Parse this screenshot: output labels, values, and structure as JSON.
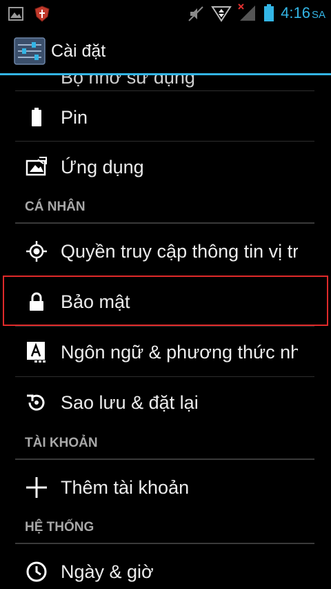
{
  "status_bar": {
    "time": "4:16",
    "ampm": "SA",
    "icons": [
      "gallery-icon",
      "shield-icon",
      "mute-icon",
      "data-arrows-icon",
      "signal-no-service-icon",
      "battery-icon"
    ]
  },
  "action_bar": {
    "title": "Cài đặt",
    "accent": "#33b5e5"
  },
  "list": {
    "partial_top_label": "Bộ nhớ sử dụng",
    "items": [
      {
        "label": "Pin",
        "icon": "battery-icon"
      },
      {
        "label": "Ứng dụng",
        "icon": "apps-icon"
      },
      {
        "label": "Quyền truy cập thông tin vị trí",
        "icon": "location-icon"
      },
      {
        "label": "Bảo mật",
        "icon": "lock-icon"
      },
      {
        "label": "Ngôn ngữ & phương thức nhập",
        "icon": "language-icon"
      },
      {
        "label": "Sao lưu & đặt lại",
        "icon": "backup-icon"
      },
      {
        "label": "Thêm tài khoản",
        "icon": "add-icon"
      },
      {
        "label": "Ngày & giờ",
        "icon": "clock-icon"
      }
    ],
    "headers": {
      "personal": "CÁ NHÂN",
      "accounts": "TÀI KHOẢN",
      "system": "HỆ THỐNG"
    }
  },
  "highlight_color": "#e02a2a"
}
